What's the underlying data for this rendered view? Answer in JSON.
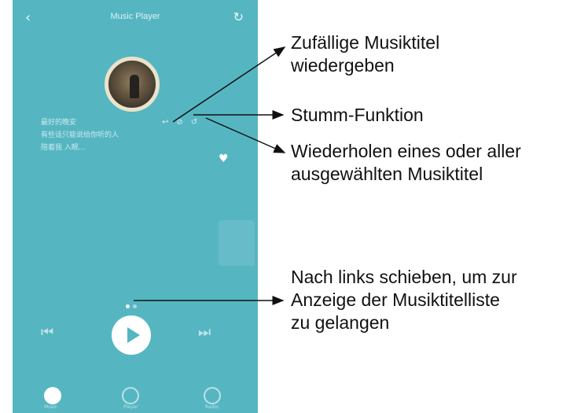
{
  "app": {
    "title": "Music Player",
    "back_icon": "‹",
    "refresh_icon": "↻",
    "song_lines": [
      "最好的晚安",
      "有些话只能说给你听的人",
      "陪着我 入眠…"
    ],
    "control_icons": [
      "↩",
      "⊘",
      "↺"
    ],
    "heart_icon": "♥",
    "prev_icon": "⏮",
    "next_icon": "⏭",
    "tabs": [
      "Music",
      "Player",
      "Radio"
    ]
  },
  "annotations": {
    "shuffle_line1": "Zufällige Musiktitel",
    "shuffle_line2": "wiedergeben",
    "mute": "Stumm-Funktion",
    "repeat_line1": "Wiederholen eines oder aller",
    "repeat_line2": "ausgewählten Musiktitel",
    "swipe_line1": "Nach links schieben, um zur",
    "swipe_line2": "Anzeige der Musiktitelliste",
    "swipe_line3": "zu gelangen"
  }
}
